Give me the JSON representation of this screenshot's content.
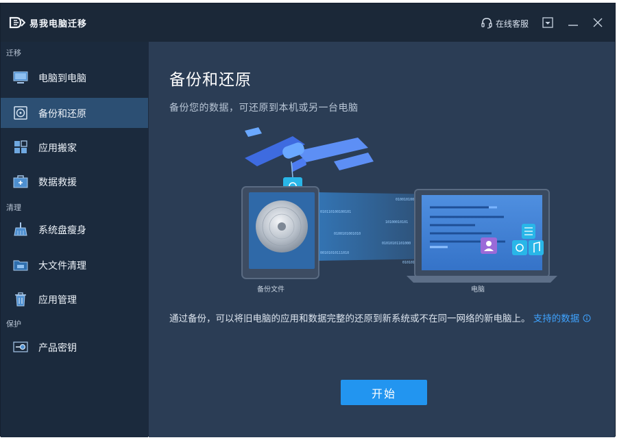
{
  "app": {
    "title": "易我电脑迁移"
  },
  "titlebar": {
    "support_label": "在线客服"
  },
  "sidebar": {
    "sections": [
      {
        "label": "迁移"
      },
      {
        "label": "清理"
      },
      {
        "label": "保护"
      }
    ],
    "items": [
      {
        "label": "电脑到电脑",
        "icon": "monitor-icon"
      },
      {
        "label": "备份和还原",
        "icon": "disc-backup-icon",
        "active": true
      },
      {
        "label": "应用搬家",
        "icon": "apps-grid-icon"
      },
      {
        "label": "数据救援",
        "icon": "briefcase-icon"
      },
      {
        "label": "系统盘瘦身",
        "icon": "broom-icon"
      },
      {
        "label": "大文件清理",
        "icon": "folder-icon"
      },
      {
        "label": "应用管理",
        "icon": "trash-icon"
      },
      {
        "label": "产品密钥",
        "icon": "key-icon"
      }
    ]
  },
  "main": {
    "title": "备份和还原",
    "subtitle": "备份您的数据，可还原到本机或另一台电脑",
    "illustration": {
      "backup_caption": "备份文件",
      "pc_caption": "电脑",
      "binary_lines": [
        "0100101000010",
        "010110100100101",
        "10100010101",
        "0100101001010",
        "01010101101000",
        "00101010111010",
        "01010101001000"
      ]
    },
    "description": "通过备份，可以将旧电脑的应用和数据完整的还原到新系统或不在同一网络的新电脑上。",
    "link": "支持的数据",
    "link_icon": "info-icon",
    "start_button": "开始"
  },
  "colors": {
    "accent": "#2295f0",
    "link": "#3fa3ff",
    "active_item": "#2c4f73",
    "sidebar_bg": "#1b2a3d",
    "main_bg": "#2b3d55"
  }
}
